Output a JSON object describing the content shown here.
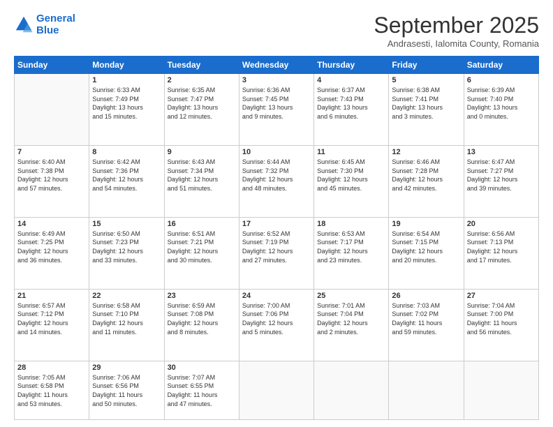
{
  "logo": {
    "line1": "General",
    "line2": "Blue"
  },
  "title": "September 2025",
  "subtitle": "Andrasesti, Ialomita County, Romania",
  "weekdays": [
    "Sunday",
    "Monday",
    "Tuesday",
    "Wednesday",
    "Thursday",
    "Friday",
    "Saturday"
  ],
  "weeks": [
    [
      {
        "day": "",
        "info": ""
      },
      {
        "day": "1",
        "info": "Sunrise: 6:33 AM\nSunset: 7:49 PM\nDaylight: 13 hours\nand 15 minutes."
      },
      {
        "day": "2",
        "info": "Sunrise: 6:35 AM\nSunset: 7:47 PM\nDaylight: 13 hours\nand 12 minutes."
      },
      {
        "day": "3",
        "info": "Sunrise: 6:36 AM\nSunset: 7:45 PM\nDaylight: 13 hours\nand 9 minutes."
      },
      {
        "day": "4",
        "info": "Sunrise: 6:37 AM\nSunset: 7:43 PM\nDaylight: 13 hours\nand 6 minutes."
      },
      {
        "day": "5",
        "info": "Sunrise: 6:38 AM\nSunset: 7:41 PM\nDaylight: 13 hours\nand 3 minutes."
      },
      {
        "day": "6",
        "info": "Sunrise: 6:39 AM\nSunset: 7:40 PM\nDaylight: 13 hours\nand 0 minutes."
      }
    ],
    [
      {
        "day": "7",
        "info": "Sunrise: 6:40 AM\nSunset: 7:38 PM\nDaylight: 12 hours\nand 57 minutes."
      },
      {
        "day": "8",
        "info": "Sunrise: 6:42 AM\nSunset: 7:36 PM\nDaylight: 12 hours\nand 54 minutes."
      },
      {
        "day": "9",
        "info": "Sunrise: 6:43 AM\nSunset: 7:34 PM\nDaylight: 12 hours\nand 51 minutes."
      },
      {
        "day": "10",
        "info": "Sunrise: 6:44 AM\nSunset: 7:32 PM\nDaylight: 12 hours\nand 48 minutes."
      },
      {
        "day": "11",
        "info": "Sunrise: 6:45 AM\nSunset: 7:30 PM\nDaylight: 12 hours\nand 45 minutes."
      },
      {
        "day": "12",
        "info": "Sunrise: 6:46 AM\nSunset: 7:28 PM\nDaylight: 12 hours\nand 42 minutes."
      },
      {
        "day": "13",
        "info": "Sunrise: 6:47 AM\nSunset: 7:27 PM\nDaylight: 12 hours\nand 39 minutes."
      }
    ],
    [
      {
        "day": "14",
        "info": "Sunrise: 6:49 AM\nSunset: 7:25 PM\nDaylight: 12 hours\nand 36 minutes."
      },
      {
        "day": "15",
        "info": "Sunrise: 6:50 AM\nSunset: 7:23 PM\nDaylight: 12 hours\nand 33 minutes."
      },
      {
        "day": "16",
        "info": "Sunrise: 6:51 AM\nSunset: 7:21 PM\nDaylight: 12 hours\nand 30 minutes."
      },
      {
        "day": "17",
        "info": "Sunrise: 6:52 AM\nSunset: 7:19 PM\nDaylight: 12 hours\nand 27 minutes."
      },
      {
        "day": "18",
        "info": "Sunrise: 6:53 AM\nSunset: 7:17 PM\nDaylight: 12 hours\nand 23 minutes."
      },
      {
        "day": "19",
        "info": "Sunrise: 6:54 AM\nSunset: 7:15 PM\nDaylight: 12 hours\nand 20 minutes."
      },
      {
        "day": "20",
        "info": "Sunrise: 6:56 AM\nSunset: 7:13 PM\nDaylight: 12 hours\nand 17 minutes."
      }
    ],
    [
      {
        "day": "21",
        "info": "Sunrise: 6:57 AM\nSunset: 7:12 PM\nDaylight: 12 hours\nand 14 minutes."
      },
      {
        "day": "22",
        "info": "Sunrise: 6:58 AM\nSunset: 7:10 PM\nDaylight: 12 hours\nand 11 minutes."
      },
      {
        "day": "23",
        "info": "Sunrise: 6:59 AM\nSunset: 7:08 PM\nDaylight: 12 hours\nand 8 minutes."
      },
      {
        "day": "24",
        "info": "Sunrise: 7:00 AM\nSunset: 7:06 PM\nDaylight: 12 hours\nand 5 minutes."
      },
      {
        "day": "25",
        "info": "Sunrise: 7:01 AM\nSunset: 7:04 PM\nDaylight: 12 hours\nand 2 minutes."
      },
      {
        "day": "26",
        "info": "Sunrise: 7:03 AM\nSunset: 7:02 PM\nDaylight: 11 hours\nand 59 minutes."
      },
      {
        "day": "27",
        "info": "Sunrise: 7:04 AM\nSunset: 7:00 PM\nDaylight: 11 hours\nand 56 minutes."
      }
    ],
    [
      {
        "day": "28",
        "info": "Sunrise: 7:05 AM\nSunset: 6:58 PM\nDaylight: 11 hours\nand 53 minutes."
      },
      {
        "day": "29",
        "info": "Sunrise: 7:06 AM\nSunset: 6:56 PM\nDaylight: 11 hours\nand 50 minutes."
      },
      {
        "day": "30",
        "info": "Sunrise: 7:07 AM\nSunset: 6:55 PM\nDaylight: 11 hours\nand 47 minutes."
      },
      {
        "day": "",
        "info": ""
      },
      {
        "day": "",
        "info": ""
      },
      {
        "day": "",
        "info": ""
      },
      {
        "day": "",
        "info": ""
      }
    ]
  ]
}
